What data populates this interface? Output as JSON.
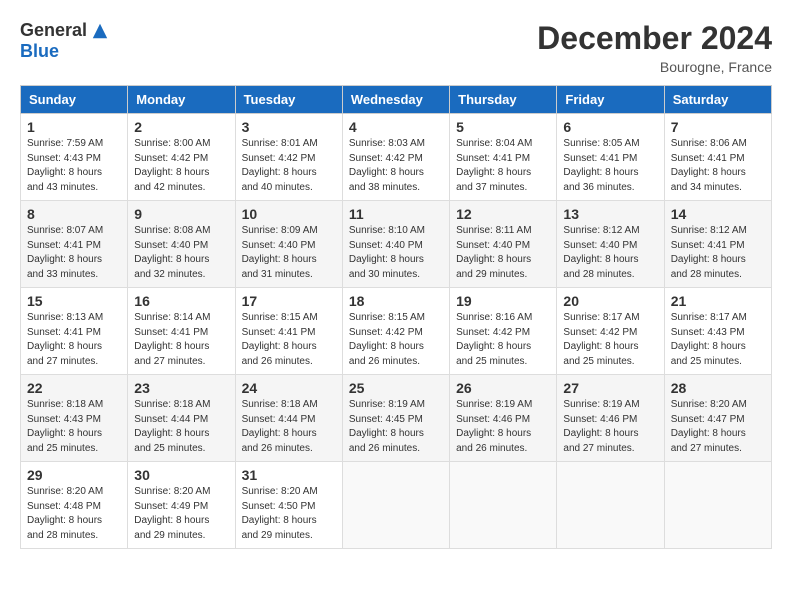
{
  "logo": {
    "general": "General",
    "blue": "Blue"
  },
  "title": "December 2024",
  "location": "Bourogne, France",
  "days_header": [
    "Sunday",
    "Monday",
    "Tuesday",
    "Wednesday",
    "Thursday",
    "Friday",
    "Saturday"
  ],
  "weeks": [
    [
      {
        "day": "1",
        "sunrise": "Sunrise: 7:59 AM",
        "sunset": "Sunset: 4:43 PM",
        "daylight": "Daylight: 8 hours and 43 minutes."
      },
      {
        "day": "2",
        "sunrise": "Sunrise: 8:00 AM",
        "sunset": "Sunset: 4:42 PM",
        "daylight": "Daylight: 8 hours and 42 minutes."
      },
      {
        "day": "3",
        "sunrise": "Sunrise: 8:01 AM",
        "sunset": "Sunset: 4:42 PM",
        "daylight": "Daylight: 8 hours and 40 minutes."
      },
      {
        "day": "4",
        "sunrise": "Sunrise: 8:03 AM",
        "sunset": "Sunset: 4:42 PM",
        "daylight": "Daylight: 8 hours and 38 minutes."
      },
      {
        "day": "5",
        "sunrise": "Sunrise: 8:04 AM",
        "sunset": "Sunset: 4:41 PM",
        "daylight": "Daylight: 8 hours and 37 minutes."
      },
      {
        "day": "6",
        "sunrise": "Sunrise: 8:05 AM",
        "sunset": "Sunset: 4:41 PM",
        "daylight": "Daylight: 8 hours and 36 minutes."
      },
      {
        "day": "7",
        "sunrise": "Sunrise: 8:06 AM",
        "sunset": "Sunset: 4:41 PM",
        "daylight": "Daylight: 8 hours and 34 minutes."
      }
    ],
    [
      {
        "day": "8",
        "sunrise": "Sunrise: 8:07 AM",
        "sunset": "Sunset: 4:41 PM",
        "daylight": "Daylight: 8 hours and 33 minutes."
      },
      {
        "day": "9",
        "sunrise": "Sunrise: 8:08 AM",
        "sunset": "Sunset: 4:40 PM",
        "daylight": "Daylight: 8 hours and 32 minutes."
      },
      {
        "day": "10",
        "sunrise": "Sunrise: 8:09 AM",
        "sunset": "Sunset: 4:40 PM",
        "daylight": "Daylight: 8 hours and 31 minutes."
      },
      {
        "day": "11",
        "sunrise": "Sunrise: 8:10 AM",
        "sunset": "Sunset: 4:40 PM",
        "daylight": "Daylight: 8 hours and 30 minutes."
      },
      {
        "day": "12",
        "sunrise": "Sunrise: 8:11 AM",
        "sunset": "Sunset: 4:40 PM",
        "daylight": "Daylight: 8 hours and 29 minutes."
      },
      {
        "day": "13",
        "sunrise": "Sunrise: 8:12 AM",
        "sunset": "Sunset: 4:40 PM",
        "daylight": "Daylight: 8 hours and 28 minutes."
      },
      {
        "day": "14",
        "sunrise": "Sunrise: 8:12 AM",
        "sunset": "Sunset: 4:41 PM",
        "daylight": "Daylight: 8 hours and 28 minutes."
      }
    ],
    [
      {
        "day": "15",
        "sunrise": "Sunrise: 8:13 AM",
        "sunset": "Sunset: 4:41 PM",
        "daylight": "Daylight: 8 hours and 27 minutes."
      },
      {
        "day": "16",
        "sunrise": "Sunrise: 8:14 AM",
        "sunset": "Sunset: 4:41 PM",
        "daylight": "Daylight: 8 hours and 27 minutes."
      },
      {
        "day": "17",
        "sunrise": "Sunrise: 8:15 AM",
        "sunset": "Sunset: 4:41 PM",
        "daylight": "Daylight: 8 hours and 26 minutes."
      },
      {
        "day": "18",
        "sunrise": "Sunrise: 8:15 AM",
        "sunset": "Sunset: 4:42 PM",
        "daylight": "Daylight: 8 hours and 26 minutes."
      },
      {
        "day": "19",
        "sunrise": "Sunrise: 8:16 AM",
        "sunset": "Sunset: 4:42 PM",
        "daylight": "Daylight: 8 hours and 25 minutes."
      },
      {
        "day": "20",
        "sunrise": "Sunrise: 8:17 AM",
        "sunset": "Sunset: 4:42 PM",
        "daylight": "Daylight: 8 hours and 25 minutes."
      },
      {
        "day": "21",
        "sunrise": "Sunrise: 8:17 AM",
        "sunset": "Sunset: 4:43 PM",
        "daylight": "Daylight: 8 hours and 25 minutes."
      }
    ],
    [
      {
        "day": "22",
        "sunrise": "Sunrise: 8:18 AM",
        "sunset": "Sunset: 4:43 PM",
        "daylight": "Daylight: 8 hours and 25 minutes."
      },
      {
        "day": "23",
        "sunrise": "Sunrise: 8:18 AM",
        "sunset": "Sunset: 4:44 PM",
        "daylight": "Daylight: 8 hours and 25 minutes."
      },
      {
        "day": "24",
        "sunrise": "Sunrise: 8:18 AM",
        "sunset": "Sunset: 4:44 PM",
        "daylight": "Daylight: 8 hours and 26 minutes."
      },
      {
        "day": "25",
        "sunrise": "Sunrise: 8:19 AM",
        "sunset": "Sunset: 4:45 PM",
        "daylight": "Daylight: 8 hours and 26 minutes."
      },
      {
        "day": "26",
        "sunrise": "Sunrise: 8:19 AM",
        "sunset": "Sunset: 4:46 PM",
        "daylight": "Daylight: 8 hours and 26 minutes."
      },
      {
        "day": "27",
        "sunrise": "Sunrise: 8:19 AM",
        "sunset": "Sunset: 4:46 PM",
        "daylight": "Daylight: 8 hours and 27 minutes."
      },
      {
        "day": "28",
        "sunrise": "Sunrise: 8:20 AM",
        "sunset": "Sunset: 4:47 PM",
        "daylight": "Daylight: 8 hours and 27 minutes."
      }
    ],
    [
      {
        "day": "29",
        "sunrise": "Sunrise: 8:20 AM",
        "sunset": "Sunset: 4:48 PM",
        "daylight": "Daylight: 8 hours and 28 minutes."
      },
      {
        "day": "30",
        "sunrise": "Sunrise: 8:20 AM",
        "sunset": "Sunset: 4:49 PM",
        "daylight": "Daylight: 8 hours and 29 minutes."
      },
      {
        "day": "31",
        "sunrise": "Sunrise: 8:20 AM",
        "sunset": "Sunset: 4:50 PM",
        "daylight": "Daylight: 8 hours and 29 minutes."
      },
      null,
      null,
      null,
      null
    ]
  ]
}
